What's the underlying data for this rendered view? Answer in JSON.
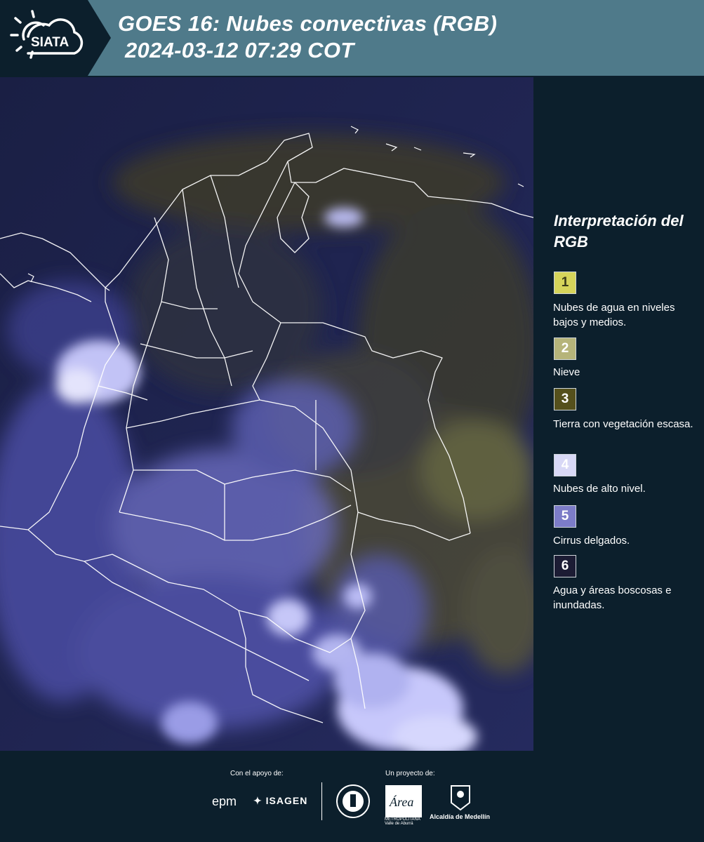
{
  "header": {
    "logo_text": "SIATA",
    "title_line1": "GOES 16: Nubes convectivas (RGB)",
    "title_line2": "2024-03-12 07:29 COT"
  },
  "legend": {
    "title": "Interpretación del RGB",
    "items": [
      {
        "number": "1",
        "color": "#d6d45a",
        "text_color": "#3a3a1a",
        "label": "Nubes de agua en niveles bajos y medios."
      },
      {
        "number": "2",
        "color": "#b6b47a",
        "text_color": "#ffffff",
        "label": "Nieve"
      },
      {
        "number": "3",
        "color": "#55501c",
        "text_color": "#ffffff",
        "label": "Tierra con vegetación escasa."
      },
      {
        "number": "4",
        "color": "#d8d8f6",
        "text_color": "#ffffff",
        "label": "Nubes de alto nivel."
      },
      {
        "number": "5",
        "color": "#7c7cc8",
        "text_color": "#ffffff",
        "label": "Cirrus delgados."
      },
      {
        "number": "6",
        "color": "#1c1c34",
        "text_color": "#ffffff",
        "label": "Agua y áreas boscosas e inundadas."
      }
    ]
  },
  "footer": {
    "support_label": "Con el apoyo de:",
    "project_label": "Un proyecto de:",
    "sponsor_epm": "epm",
    "sponsor_isagen": "ISAGEN",
    "project_area": "Área",
    "project_area_sub": "METROPOLITANA Valle de Aburrá",
    "project_alcaldia": "Alcaldía de Medellín"
  },
  "map": {
    "icon": "satellite-image",
    "colors": {
      "ocean": "#1e2452",
      "cloud_high": "#c9caf8",
      "cloud_mid": "#6f72c8",
      "land": "#4a4a30",
      "borders": "#ffffff"
    }
  }
}
